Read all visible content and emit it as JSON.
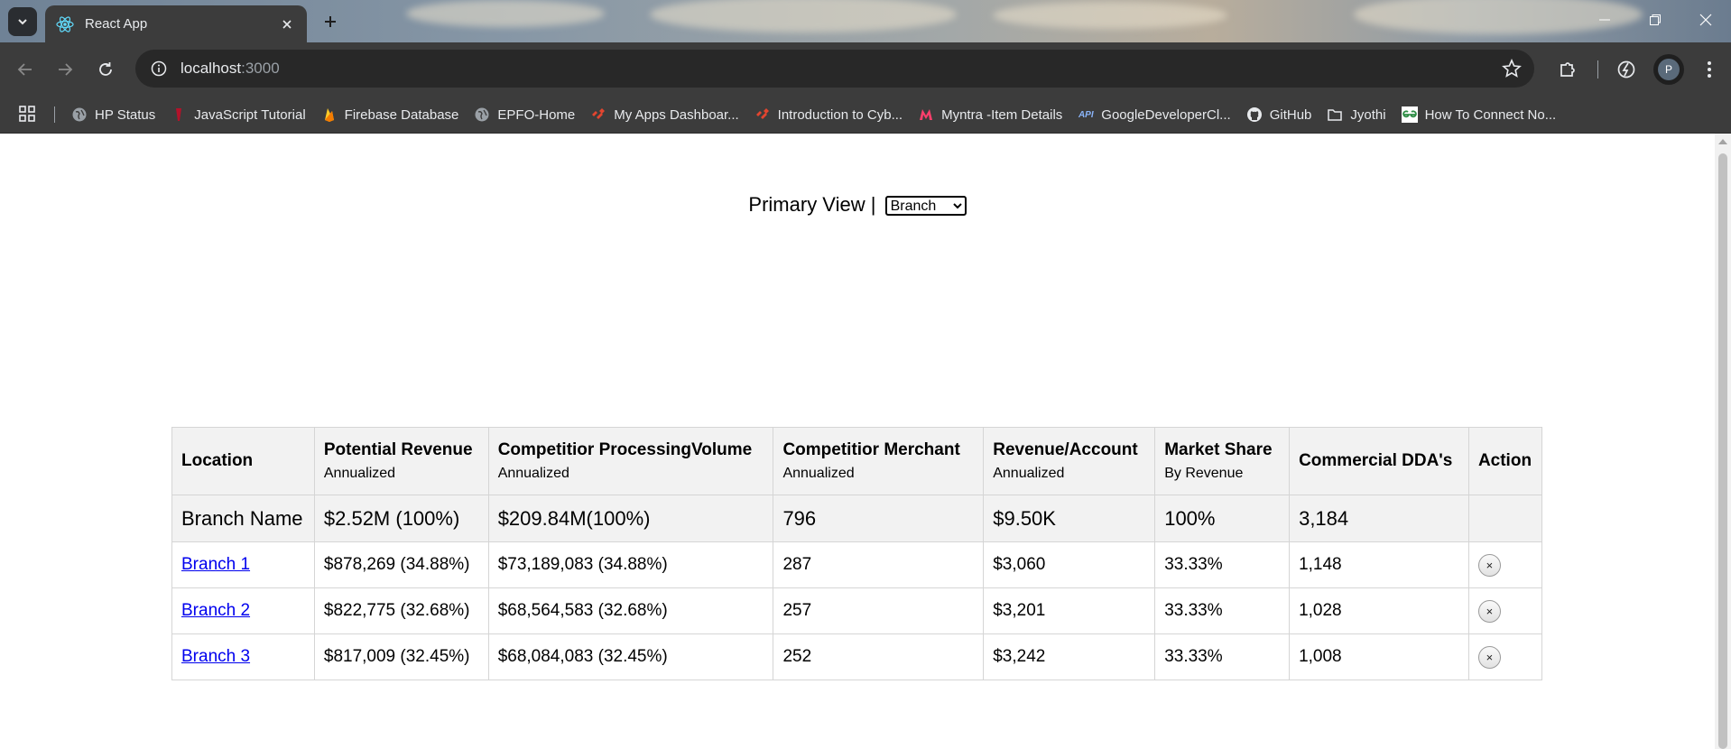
{
  "browser": {
    "tab_title": "React App",
    "url_host": "localhost",
    "url_port": ":3000",
    "profile_initial": "P",
    "bookmarks": [
      {
        "label": "HP Status",
        "icon": "globe-icon"
      },
      {
        "label": "JavaScript Tutorial",
        "icon": "javascript-tutorial-icon"
      },
      {
        "label": "Firebase Database",
        "icon": "firebase-icon"
      },
      {
        "label": "EPFO-Home",
        "icon": "globe-icon"
      },
      {
        "label": "My Apps Dashboar...",
        "icon": "dashboard-icon"
      },
      {
        "label": "Introduction to Cyb...",
        "icon": "dashboard-icon"
      },
      {
        "label": "Myntra -Item Details",
        "icon": "myntra-icon"
      },
      {
        "label": "GoogleDeveloperCl...",
        "icon": "api-icon"
      },
      {
        "label": "GitHub",
        "icon": "github-icon"
      },
      {
        "label": "Jyothi",
        "icon": "folder-icon"
      },
      {
        "label": "How To Connect No...",
        "icon": "geeksforgeeks-icon"
      }
    ]
  },
  "page": {
    "primary_view_label": "Primary View |",
    "view_select_value": "Branch",
    "table": {
      "headers": [
        {
          "title": "Location",
          "sub": ""
        },
        {
          "title": "Potential Revenue",
          "sub": "Annualized"
        },
        {
          "title": "Competitior ProcessingVolume",
          "sub": "Annualized"
        },
        {
          "title": "Competitior Merchant",
          "sub": "Annualized"
        },
        {
          "title": "Revenue/Account",
          "sub": "Annualized"
        },
        {
          "title": "Market Share",
          "sub": "By Revenue"
        },
        {
          "title": "Commercial DDA's",
          "sub": ""
        },
        {
          "title": "Action",
          "sub": ""
        }
      ],
      "summary": [
        "Branch Name",
        "$2.52M (100%)",
        "$209.84M(100%)",
        "796",
        "$9.50K",
        "100%",
        "3,184",
        ""
      ],
      "rows": [
        [
          "Branch 1",
          "$878,269 (34.88%)",
          "$73,189,083 (34.88%)",
          "287",
          "$3,060",
          "33.33%",
          "1,148"
        ],
        [
          "Branch 2",
          "$822,775 (32.68%)",
          "$68,564,583 (32.68%)",
          "257",
          "$3,201",
          "33.33%",
          "1,028"
        ],
        [
          "Branch 3",
          "$817,009 (32.45%)",
          "$68,084,083 (32.45%)",
          "252",
          "$3,242",
          "33.33%",
          "1,008"
        ]
      ],
      "remove_symbol": "×"
    }
  }
}
